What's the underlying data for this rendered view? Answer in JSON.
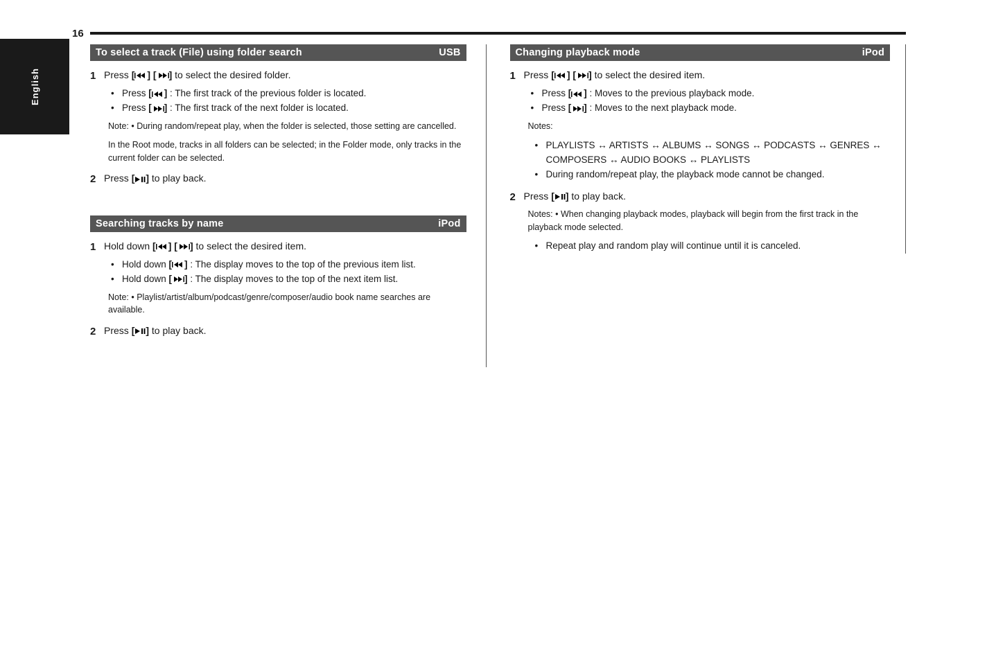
{
  "pageNumber": "16",
  "sideTab": "English",
  "sec1": {
    "title": "To select a track (File) using folder search",
    "tag": "USB",
    "step1_a": "Press ",
    "step1_b": " to select the desired folder.",
    "b1_a": "Press ",
    "b1_b": ": The first track of the previous folder is located.",
    "b2_a": "Press ",
    "b2_b": ": The first track of the next folder is located.",
    "note": "Note: • During random/repeat play, when the folder is selected, those setting are cancelled.",
    "hint": "In the Root mode, tracks in all folders can be selected; in the Folder mode, only tracks in the current folder can be selected.",
    "step2_a": "Press ",
    "step2_b": " to play back."
  },
  "sec2": {
    "title": "Searching tracks by name",
    "tag": "iPod",
    "step1_a": "Hold down ",
    "step1_b": " to select the desired item.",
    "b1_a": "Hold down ",
    "b1_b": ": The display moves to the top of the previous item list.",
    "b2_a": "Hold down ",
    "b2_b": ": The display moves to the top of the next item list.",
    "note": "Note: • Playlist/artist/album/podcast/genre/composer/audio book name searches are available.",
    "step2_a": "Press ",
    "step2_b": " to play back."
  },
  "sec3": {
    "title": "Changing playback mode",
    "tag": "iPod",
    "step1_a": "Press ",
    "step1_b": " to select the desired item.",
    "b1_a": "Press ",
    "b1_b": ": Moves to the previous playback mode.",
    "b2_a": "Press ",
    "b2_b": ": Moves to the next playback mode.",
    "notesHeading": "Notes:",
    "notes": [
      "PLAYLISTS ↔ ARTISTS ↔ ALBUMS ↔ SONGS ↔ PODCASTS ↔ GENRES ↔ COMPOSERS ↔ AUDIO BOOKS ↔ PLAYLISTS",
      "During random/repeat play, the playback mode cannot be changed."
    ],
    "step2_a": "Press ",
    "step2_b": " to play back.",
    "note2": "Notes: • When changing playback modes, playback will begin from the first track in the playback mode selected.",
    "note2b": "Repeat play and random play will continue until it is canceled."
  }
}
